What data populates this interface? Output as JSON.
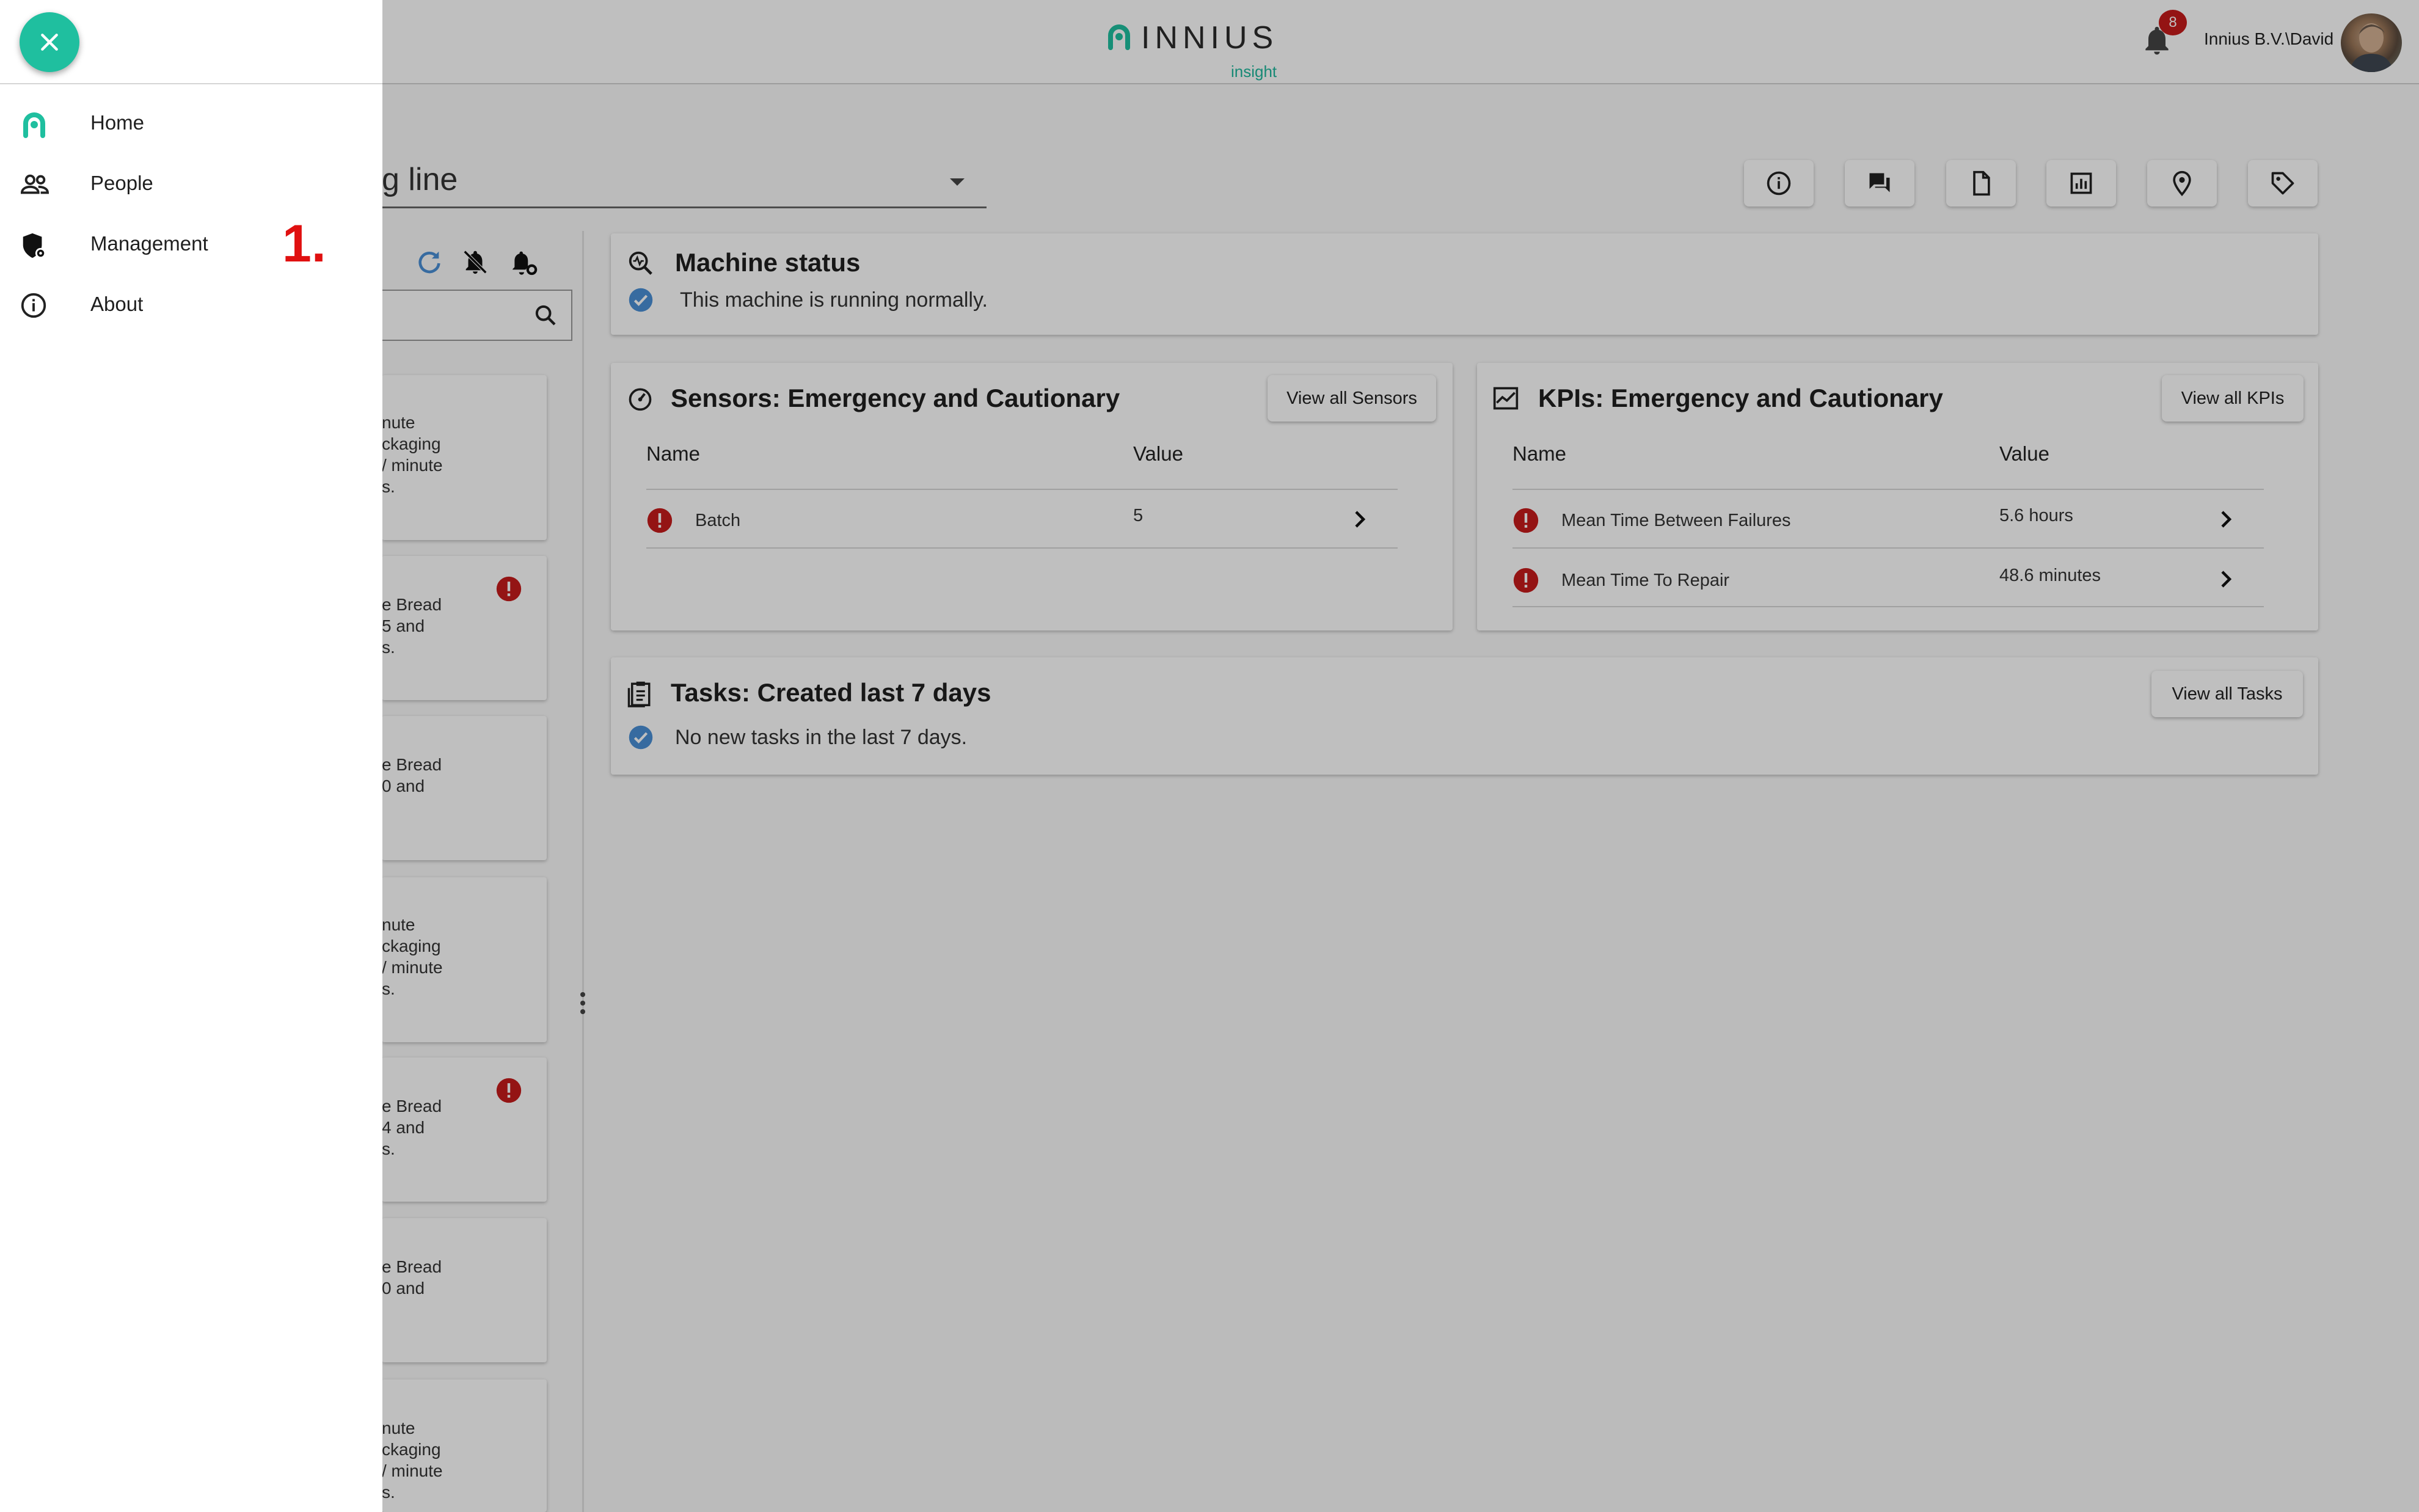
{
  "header": {
    "brand_name": "INNIUS",
    "brand_sub": "insight",
    "notification_count": "8",
    "user_name": "Innius B.V.\\David"
  },
  "machine_selector": {
    "value": "g line"
  },
  "toolbar_icons": [
    "info-icon",
    "chat-icon",
    "document-icon",
    "report-icon",
    "location-icon",
    "tag-icon"
  ],
  "machine_list": {
    "tool_icons": [
      "refresh-icon",
      "notifications-off-icon",
      "notification-settings-icon"
    ],
    "cards": [
      {
        "text": "nute\nckaging\n/ minute\ns.",
        "alert": false
      },
      {
        "text": "e Bread\n5 and\ns.",
        "alert": true
      },
      {
        "text": "e Bread\n0 and",
        "alert": false
      },
      {
        "text": "nute\nckaging\n/ minute\ns.",
        "alert": false
      },
      {
        "text": "e Bread\n4 and\ns.",
        "alert": true
      },
      {
        "text": "e Bread\n0 and",
        "alert": false
      },
      {
        "text": "nute\nckaging\n/ minute\ns.",
        "alert": false
      }
    ]
  },
  "machine_status": {
    "title": "Machine status",
    "message": "This machine is running normally."
  },
  "sensors": {
    "title": "Sensors: Emergency and Cautionary",
    "button": "View all Sensors",
    "col_name": "Name",
    "col_value": "Value",
    "rows": [
      {
        "name": "Batch",
        "value": "5"
      }
    ]
  },
  "kpis": {
    "title": "KPIs: Emergency and Cautionary",
    "button": "View all KPIs",
    "col_name": "Name",
    "col_value": "Value",
    "rows": [
      {
        "name": "Mean Time Between Failures",
        "value": "5.6 hours"
      },
      {
        "name": "Mean Time To Repair",
        "value": "48.6 minutes"
      }
    ]
  },
  "tasks": {
    "title": "Tasks: Created last 7 days",
    "button": "View all Tasks",
    "message": "No new tasks in the last 7 days."
  },
  "drawer": {
    "items": [
      {
        "label": "Home",
        "icon": "innius-logo-icon"
      },
      {
        "label": "People",
        "icon": "people-icon"
      },
      {
        "label": "Management",
        "icon": "management-shield-icon"
      },
      {
        "label": "About",
        "icon": "info-icon"
      }
    ],
    "step_marker": "1."
  },
  "colors": {
    "accent": "#1fbf9f",
    "alert": "#c61b1b",
    "check": "#4a8fd6"
  }
}
